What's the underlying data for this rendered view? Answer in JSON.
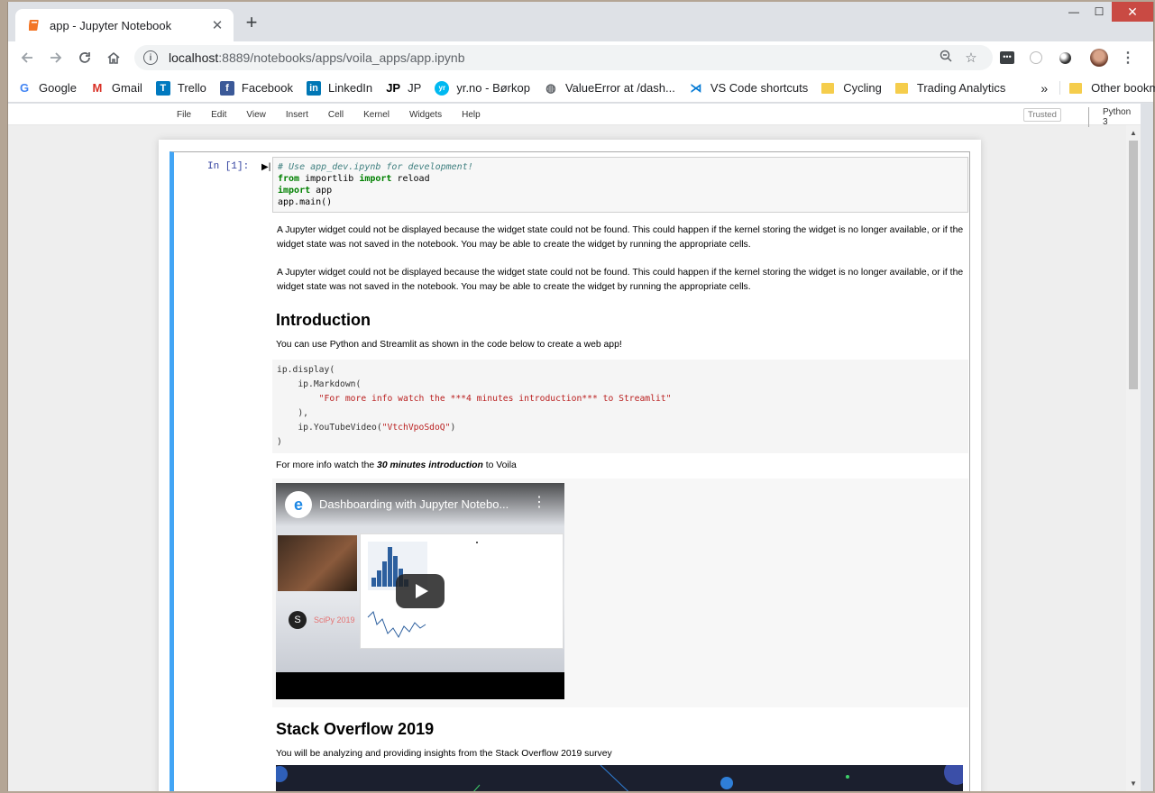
{
  "browser": {
    "tab_title": "app - Jupyter Notebook",
    "new_tab": "+",
    "url_host": "localhost",
    "url_rest": ":8889/notebooks/apps/voila_apps/app.ipynb",
    "window_controls": {
      "minimize": "—",
      "maximize": "☐",
      "close": "✕"
    }
  },
  "bookmarks": [
    {
      "label": "Google",
      "icon": "google-icon",
      "color": "#4285f4",
      "glyph": "G"
    },
    {
      "label": "Gmail",
      "icon": "gmail-icon",
      "color": "#d93025",
      "glyph": "M"
    },
    {
      "label": "Trello",
      "icon": "trello-icon",
      "color": "#0079bf",
      "glyph": "T"
    },
    {
      "label": "Facebook",
      "icon": "facebook-icon",
      "color": "#3b5998",
      "glyph": "f"
    },
    {
      "label": "LinkedIn",
      "icon": "linkedin-icon",
      "color": "#0077b5",
      "glyph": "in"
    },
    {
      "label": "JP",
      "icon": "jp-icon",
      "color": "#000000",
      "glyph": "JP"
    },
    {
      "label": "yr.no - Børkop",
      "icon": "yr-icon",
      "color": "#00b9f1",
      "glyph": "yr"
    },
    {
      "label": "ValueError at /dash...",
      "icon": "globe-icon",
      "color": "#5f6368",
      "glyph": "◍"
    },
    {
      "label": "VS Code shortcuts",
      "icon": "vscode-icon",
      "color": "#0078d4",
      "glyph": "⋊"
    }
  ],
  "bookmark_folders": [
    "Cycling",
    "Trading Analytics"
  ],
  "bookmark_more": "»",
  "other_bookmarks": "Other bookmarks",
  "jupyter": {
    "menu": [
      "File",
      "Edit",
      "View",
      "Insert",
      "Cell",
      "Kernel",
      "Widgets",
      "Help"
    ],
    "trusted": "Trusted",
    "kernel": "Python 3"
  },
  "cell": {
    "prompt": "In [1]:",
    "code_comment": "# Use app_dev.ipynb for development!",
    "code_line2_kw1": "from",
    "code_line2_mod": " importlib ",
    "code_line2_kw2": "import",
    "code_line2_name": " reload",
    "code_line3_kw": "import",
    "code_line3_name": " app",
    "code_line4": "app.main()"
  },
  "output": {
    "widget_msg_1": "A Jupyter widget could not be displayed because the widget state could not be found. This could happen if the kernel storing the widget is no longer available, or if the widget state was not saved in the notebook. You may be able to create the widget by running the appropriate cells.",
    "widget_msg_2": "A Jupyter widget could not be displayed because the widget state could not be found. This could happen if the kernel storing the widget is no longer available, or if the widget state was not saved in the notebook. You may be able to create the widget by running the appropriate cells.",
    "intro_heading": "Introduction",
    "intro_text": "You can use Python and Streamlit as shown in the code below to create a web app!",
    "code_l1": "ip.display(",
    "code_l2": "    ip.Markdown(",
    "code_l3": "\"For more info watch the ***4 minutes introduction*** to Streamlit\"",
    "code_l4": "    ),",
    "code_l5a": "    ip.YouTubeVideo(",
    "code_l5b": "\"VtchVpoSdoQ\"",
    "code_l5c": ")",
    "code_l6": ")",
    "more_info_prefix": "For more info watch the ",
    "more_info_em": "30 minutes introduction",
    "more_info_suffix": " to Voila",
    "video_title": "Dashboarding with Jupyter Notebo...",
    "video_badge": "SciPy 2019",
    "so_heading": "Stack Overflow 2019",
    "so_text": "You will be analyzing and providing insights from the Stack Overflow 2019 survey"
  }
}
